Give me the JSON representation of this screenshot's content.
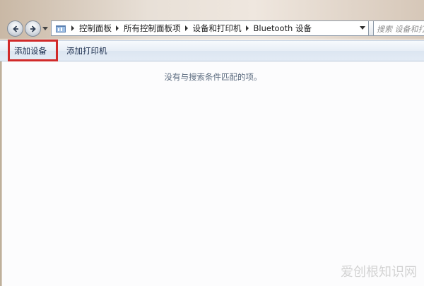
{
  "navigation": {
    "back_icon": "back-arrow-icon",
    "forward_icon": "forward-arrow-icon"
  },
  "address_bar": {
    "icon": "folder-icon",
    "breadcrumbs": [
      "控制面板",
      "所有控制面板项",
      "设备和打印机",
      "Bluetooth 设备"
    ]
  },
  "search": {
    "placeholder": "搜索 设备和打印机"
  },
  "command_bar": {
    "add_device": "添加设备",
    "add_printer": "添加打印机",
    "highlight_color": "#d12a2a"
  },
  "main": {
    "empty_message": "没有与搜索条件匹配的项。"
  },
  "watermark": {
    "text": "爱创根知识网"
  }
}
